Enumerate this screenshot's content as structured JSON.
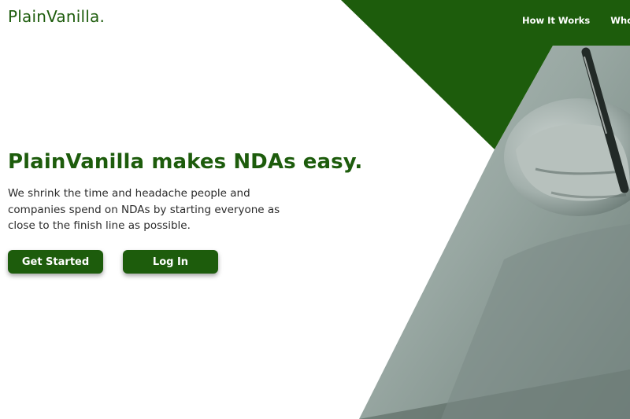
{
  "brand": {
    "logo": "PlainVanilla."
  },
  "nav": {
    "items": [
      {
        "label": "How It Works"
      },
      {
        "label": "Who W"
      }
    ]
  },
  "hero": {
    "headline": "PlainVanilla makes NDAs easy.",
    "description": "We shrink the time and headache people and companies spend on NDAs by starting everyone as close to the finish line as possible.",
    "cta_primary": "Get Started",
    "cta_secondary": "Log In"
  },
  "colors": {
    "brand_green": "#1d5c0c",
    "photo_tint": "#8c9c96"
  }
}
